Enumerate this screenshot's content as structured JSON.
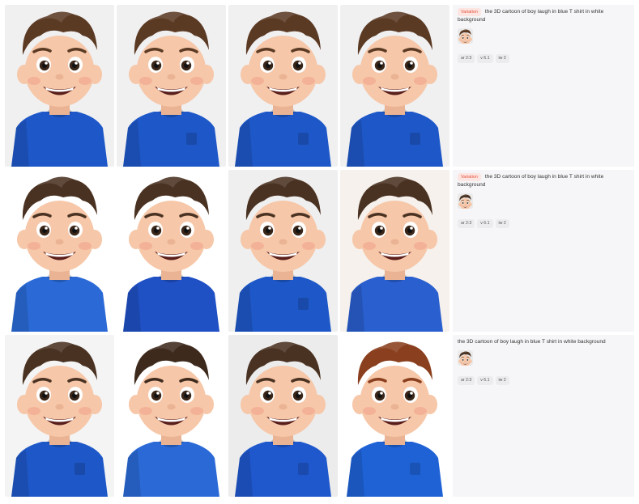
{
  "jobs": [
    {
      "variation_label": "Variation",
      "prompt": "the 3D cartoon of boy laugh in blue T shirt in white background",
      "params": {
        "ar": "ar 2:3",
        "v": "v 6.1",
        "iw": "iw 2"
      },
      "images": [
        {
          "name": "Generated image 1",
          "bg": "#f0f0f1",
          "hair": "#5b3a24",
          "shirt": "#1e58c8",
          "pocket": false
        },
        {
          "name": "Generated image 2",
          "bg": "#f0f0f1",
          "hair": "#5b3a24",
          "shirt": "#1e58c8",
          "pocket": true
        },
        {
          "name": "Generated image 3",
          "bg": "#f0f0f1",
          "hair": "#5b3a24",
          "shirt": "#1e58c8",
          "pocket": true
        },
        {
          "name": "Generated image 4",
          "bg": "#f0f0f1",
          "hair": "#5b3a24",
          "shirt": "#1e58c8",
          "pocket": true
        }
      ]
    },
    {
      "variation_label": "Variation",
      "prompt": "the 3D cartoon of boy laugh in blue T shirt in white background",
      "params": {
        "ar": "ar 2:3",
        "v": "v 6.1",
        "iw": "iw 2"
      },
      "images": [
        {
          "name": "Generated image 5",
          "bg": "#ffffff",
          "hair": "#4a3222",
          "shirt": "#2b6ad6",
          "pocket": false
        },
        {
          "name": "Generated image 6",
          "bg": "#ffffff",
          "hair": "#4a3222",
          "shirt": "#1f50c4",
          "pocket": false
        },
        {
          "name": "Generated image 7",
          "bg": "#efefef",
          "hair": "#4a3222",
          "shirt": "#1e58c8",
          "pocket": true
        },
        {
          "name": "Generated image 8",
          "bg": "#f6f1ec",
          "hair": "#4a3222",
          "shirt": "#2a5fcf",
          "pocket": false
        }
      ]
    },
    {
      "variation_label": "",
      "prompt": "the 3D cartoon of boy laugh in blue T shirt in white background",
      "params": {
        "ar": "ar 2:3",
        "v": "v 6.1",
        "iw": "iw 2"
      },
      "images": [
        {
          "name": "Generated image 9",
          "bg": "#f4f4f4",
          "hair": "#4a3222",
          "shirt": "#1e58c8",
          "pocket": true
        },
        {
          "name": "Generated image 10",
          "bg": "#ffffff",
          "hair": "#3e2a1d",
          "shirt": "#2b6ad6",
          "pocket": false
        },
        {
          "name": "Generated image 11",
          "bg": "#ececec",
          "hair": "#4a3222",
          "shirt": "#1f57cc",
          "pocket": true
        },
        {
          "name": "Generated image 12",
          "bg": "#ffffff",
          "hair": "#8a3f1e",
          "shirt": "#1e62d6",
          "pocket": true
        }
      ]
    }
  ],
  "colors": {
    "accent": "#e5533d",
    "panel": "#f6f6f8"
  },
  "icons": {
    "ref": "reference-image-thumbnail"
  }
}
